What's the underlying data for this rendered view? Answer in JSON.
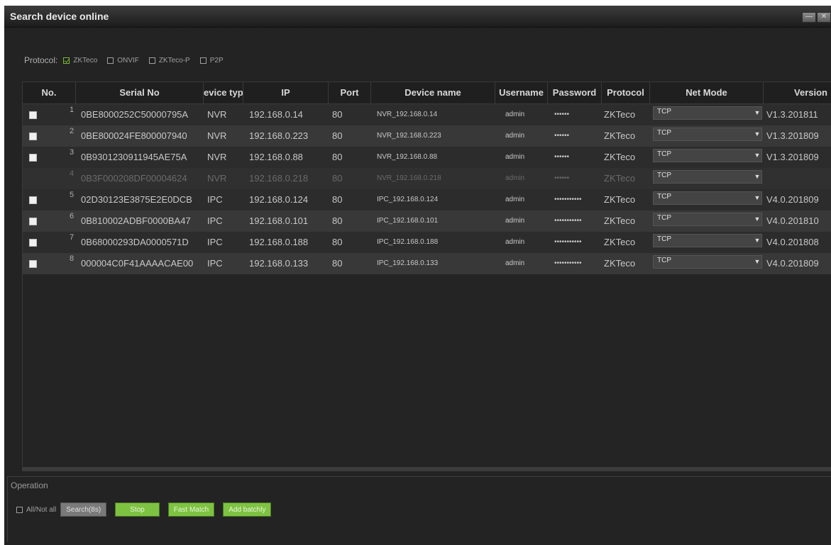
{
  "window": {
    "title": "Search device online",
    "min_icon": "minimize-icon",
    "close_icon": "close-icon"
  },
  "protocol": {
    "label": "Protocol:",
    "options": [
      {
        "label": "ZKTeco",
        "checked": true
      },
      {
        "label": "ONVIF",
        "checked": false
      },
      {
        "label": "ZKTeco-P",
        "checked": false
      },
      {
        "label": "P2P",
        "checked": false
      }
    ]
  },
  "table": {
    "headers": [
      "No.",
      "Serial No",
      "evice typ",
      "IP",
      "Port",
      "Device name",
      "Username",
      "Password",
      "Protocol",
      "Net Mode",
      "Version"
    ],
    "rows": [
      {
        "no": "1",
        "serial": "0BE8000252C50000795A",
        "type": "NVR",
        "ip": "192.168.0.14",
        "port": "80",
        "name": "NVR_192.168.0.14",
        "user": "admin",
        "password": "••••••",
        "protocol": "ZKTeco",
        "netmode": "TCP",
        "version": "V1.3.201811",
        "disabled": false
      },
      {
        "no": "2",
        "serial": "0BE800024FE800007940",
        "type": "NVR",
        "ip": "192.168.0.223",
        "port": "80",
        "name": "NVR_192.168.0.223",
        "user": "admin",
        "password": "••••••",
        "protocol": "ZKTeco",
        "netmode": "TCP",
        "version": "V1.3.201809",
        "disabled": false
      },
      {
        "no": "3",
        "serial": "0B9301230911945AE75A",
        "type": "NVR",
        "ip": "192.168.0.88",
        "port": "80",
        "name": "NVR_192.168.0.88",
        "user": "admin",
        "password": "••••••",
        "protocol": "ZKTeco",
        "netmode": "TCP",
        "version": "V1.3.201809",
        "disabled": false
      },
      {
        "no": "4",
        "serial": "0B3F000208DF00004624",
        "type": "NVR",
        "ip": "192.168.0.218",
        "port": "80",
        "name": "NVR_192.168.0.218",
        "user": "admin",
        "password": "••••••",
        "protocol": "ZKTeco",
        "netmode": "TCP",
        "version": "",
        "disabled": true
      },
      {
        "no": "5",
        "serial": "02D30123E3875E2E0DCB",
        "type": "IPC",
        "ip": "192.168.0.124",
        "port": "80",
        "name": "IPC_192.168.0.124",
        "user": "admin",
        "password": "•••••••••••",
        "protocol": "ZKTeco",
        "netmode": "TCP",
        "version": "V4.0.201809",
        "disabled": false
      },
      {
        "no": "6",
        "serial": "0B810002ADBF0000BA47",
        "type": "IPC",
        "ip": "192.168.0.101",
        "port": "80",
        "name": "IPC_192.168.0.101",
        "user": "admin",
        "password": "•••••••••••",
        "protocol": "ZKTeco",
        "netmode": "TCP",
        "version": "V4.0.201810",
        "disabled": false
      },
      {
        "no": "7",
        "serial": "0B68000293DA0000571D",
        "type": "IPC",
        "ip": "192.168.0.188",
        "port": "80",
        "name": "IPC_192.168.0.188",
        "user": "admin",
        "password": "•••••••••••",
        "protocol": "ZKTeco",
        "netmode": "TCP",
        "version": "V4.0.201808",
        "disabled": false
      },
      {
        "no": "8",
        "serial": "000004C0F41AAAACAE00",
        "type": "IPC",
        "ip": "192.168.0.133",
        "port": "80",
        "name": "IPC_192.168.0.133",
        "user": "admin",
        "password": "•••••••••••",
        "protocol": "ZKTeco",
        "netmode": "TCP",
        "version": "V4.0.201809",
        "disabled": false
      }
    ]
  },
  "operation": {
    "title": "Operation",
    "all_label": "All/Not all",
    "search_label": "Search(8s)",
    "stop_label": "Stop",
    "fast_match_label": "Fast Match",
    "add_batchly_label": "Add batchly"
  },
  "colors": {
    "accent_green": "#7ec242",
    "window_bg": "#232323"
  }
}
